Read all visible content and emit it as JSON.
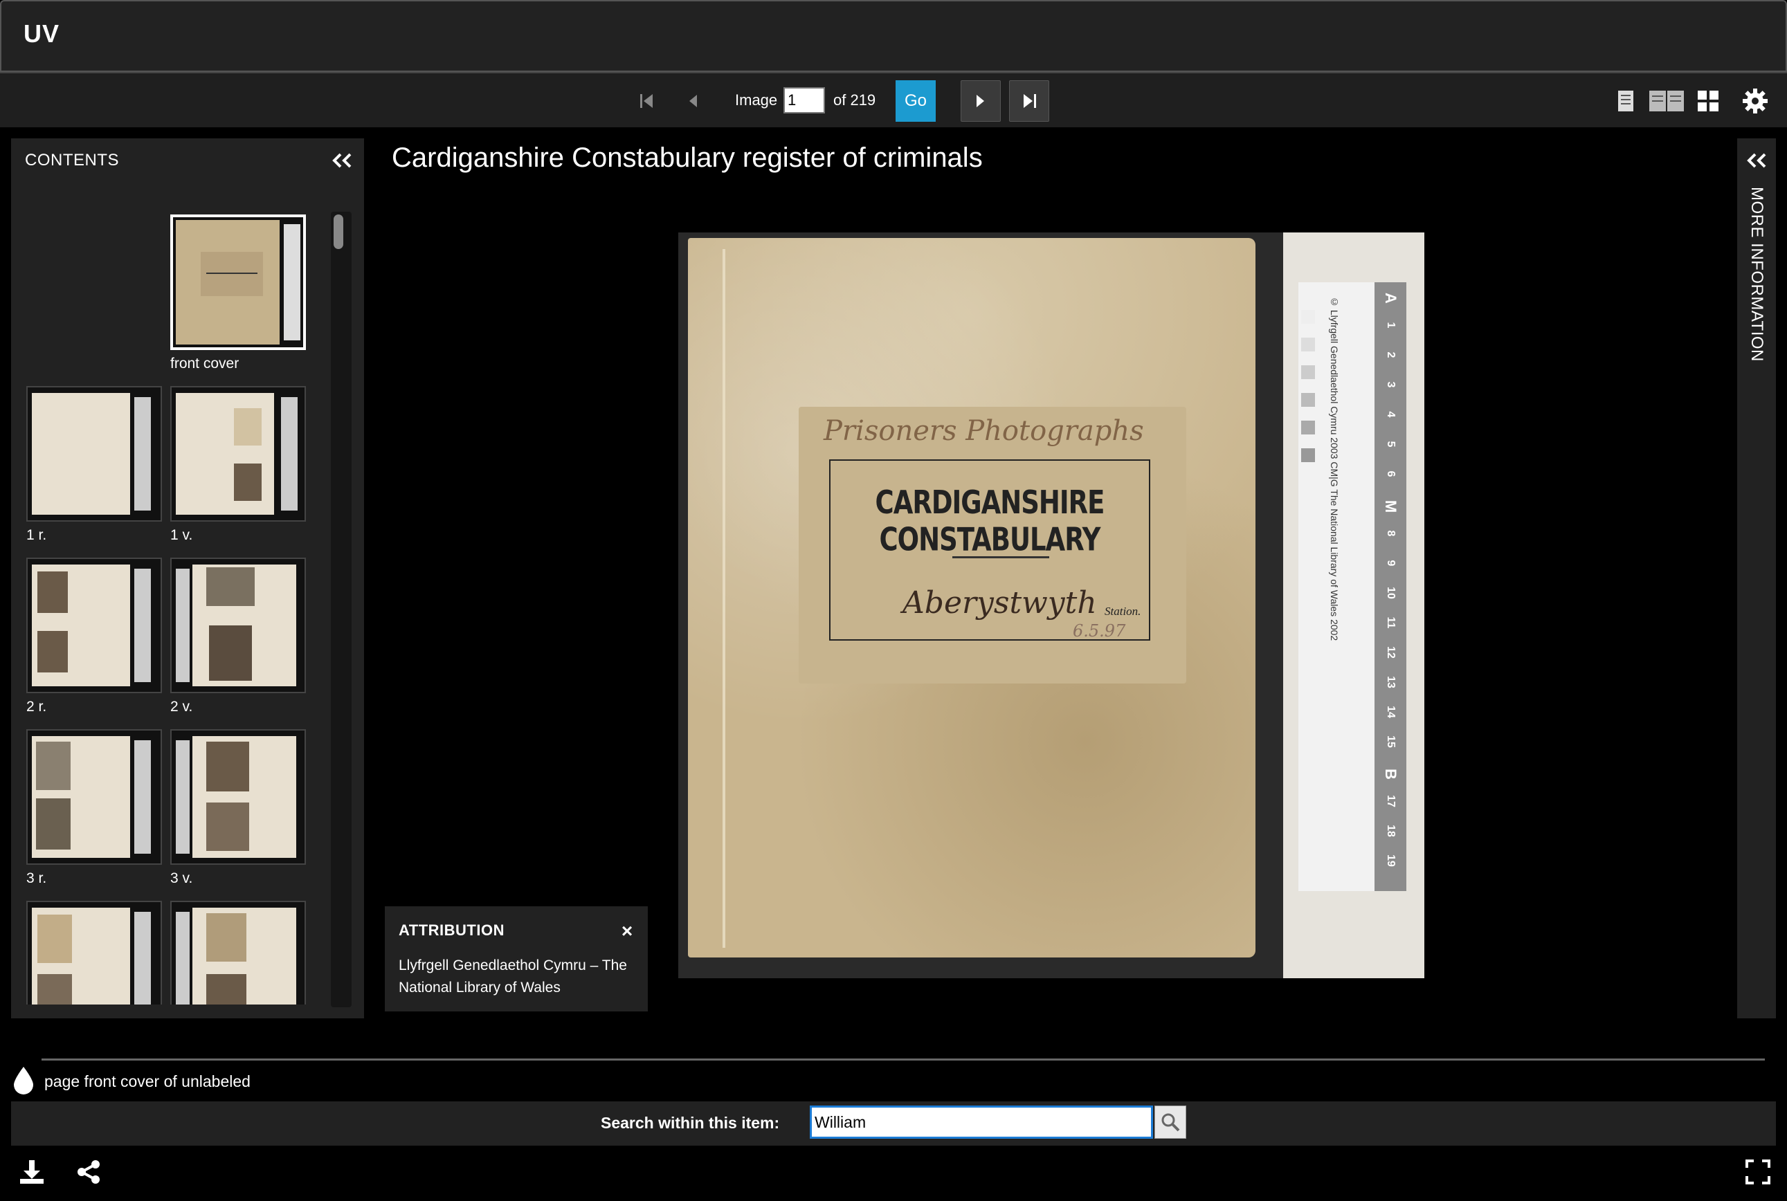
{
  "app": {
    "brand": "UV"
  },
  "pager": {
    "first_icon": "first-page-icon",
    "prev_icon": "previous-page-icon",
    "image_label": "Image",
    "image_value": "1",
    "of_label": "of 219",
    "go_label": "Go",
    "next_icon": "next-page-icon",
    "last_icon": "last-page-icon",
    "accent_color": "#1c9bd0"
  },
  "view_modes": [
    "one-up-view-icon",
    "two-up-view-icon",
    "gallery-view-icon",
    "settings-icon"
  ],
  "contents": {
    "title": "CONTENTS",
    "thumbnails": [
      {
        "label": "front cover",
        "selected": true
      },
      {
        "label": "1 r."
      },
      {
        "label": "1 v."
      },
      {
        "label": "2 r."
      },
      {
        "label": "2 v."
      },
      {
        "label": "3 r."
      },
      {
        "label": "3 v."
      },
      {
        "label": ""
      },
      {
        "label": ""
      }
    ]
  },
  "main": {
    "title": "Cardiganshire Constabulary register of criminals",
    "book_label": {
      "script_top": "Prisoners Photographs",
      "heading": "CARDIGANSHIRE CONSTABULARY",
      "script_station": "Aberystwyth",
      "station_text": "Station.",
      "date": "6.5.97"
    },
    "ruler": {
      "credit": "© Llyfrgell Genedlaethol Cymru 2003  CM|G  The National Library of Wales 2002",
      "marks": [
        "A",
        "1",
        "2",
        "3",
        "4",
        "5",
        "6",
        "M",
        "8",
        "9",
        "10",
        "11",
        "12",
        "13",
        "14",
        "15",
        "B",
        "17",
        "18",
        "19"
      ]
    }
  },
  "attribution": {
    "title": "ATTRIBUTION",
    "close": "×",
    "text": "Llyfrgell Genedlaethol Cymru – The National Library of Wales"
  },
  "more_info": {
    "label": "MORE INFORMATION"
  },
  "status": {
    "page_text": "page front cover of unlabeled"
  },
  "search": {
    "label": "Search within this item:",
    "value": "William"
  },
  "footer": {
    "download_icon": "download-icon",
    "share_icon": "share-icon",
    "fullscreen_icon": "fullscreen-icon"
  }
}
